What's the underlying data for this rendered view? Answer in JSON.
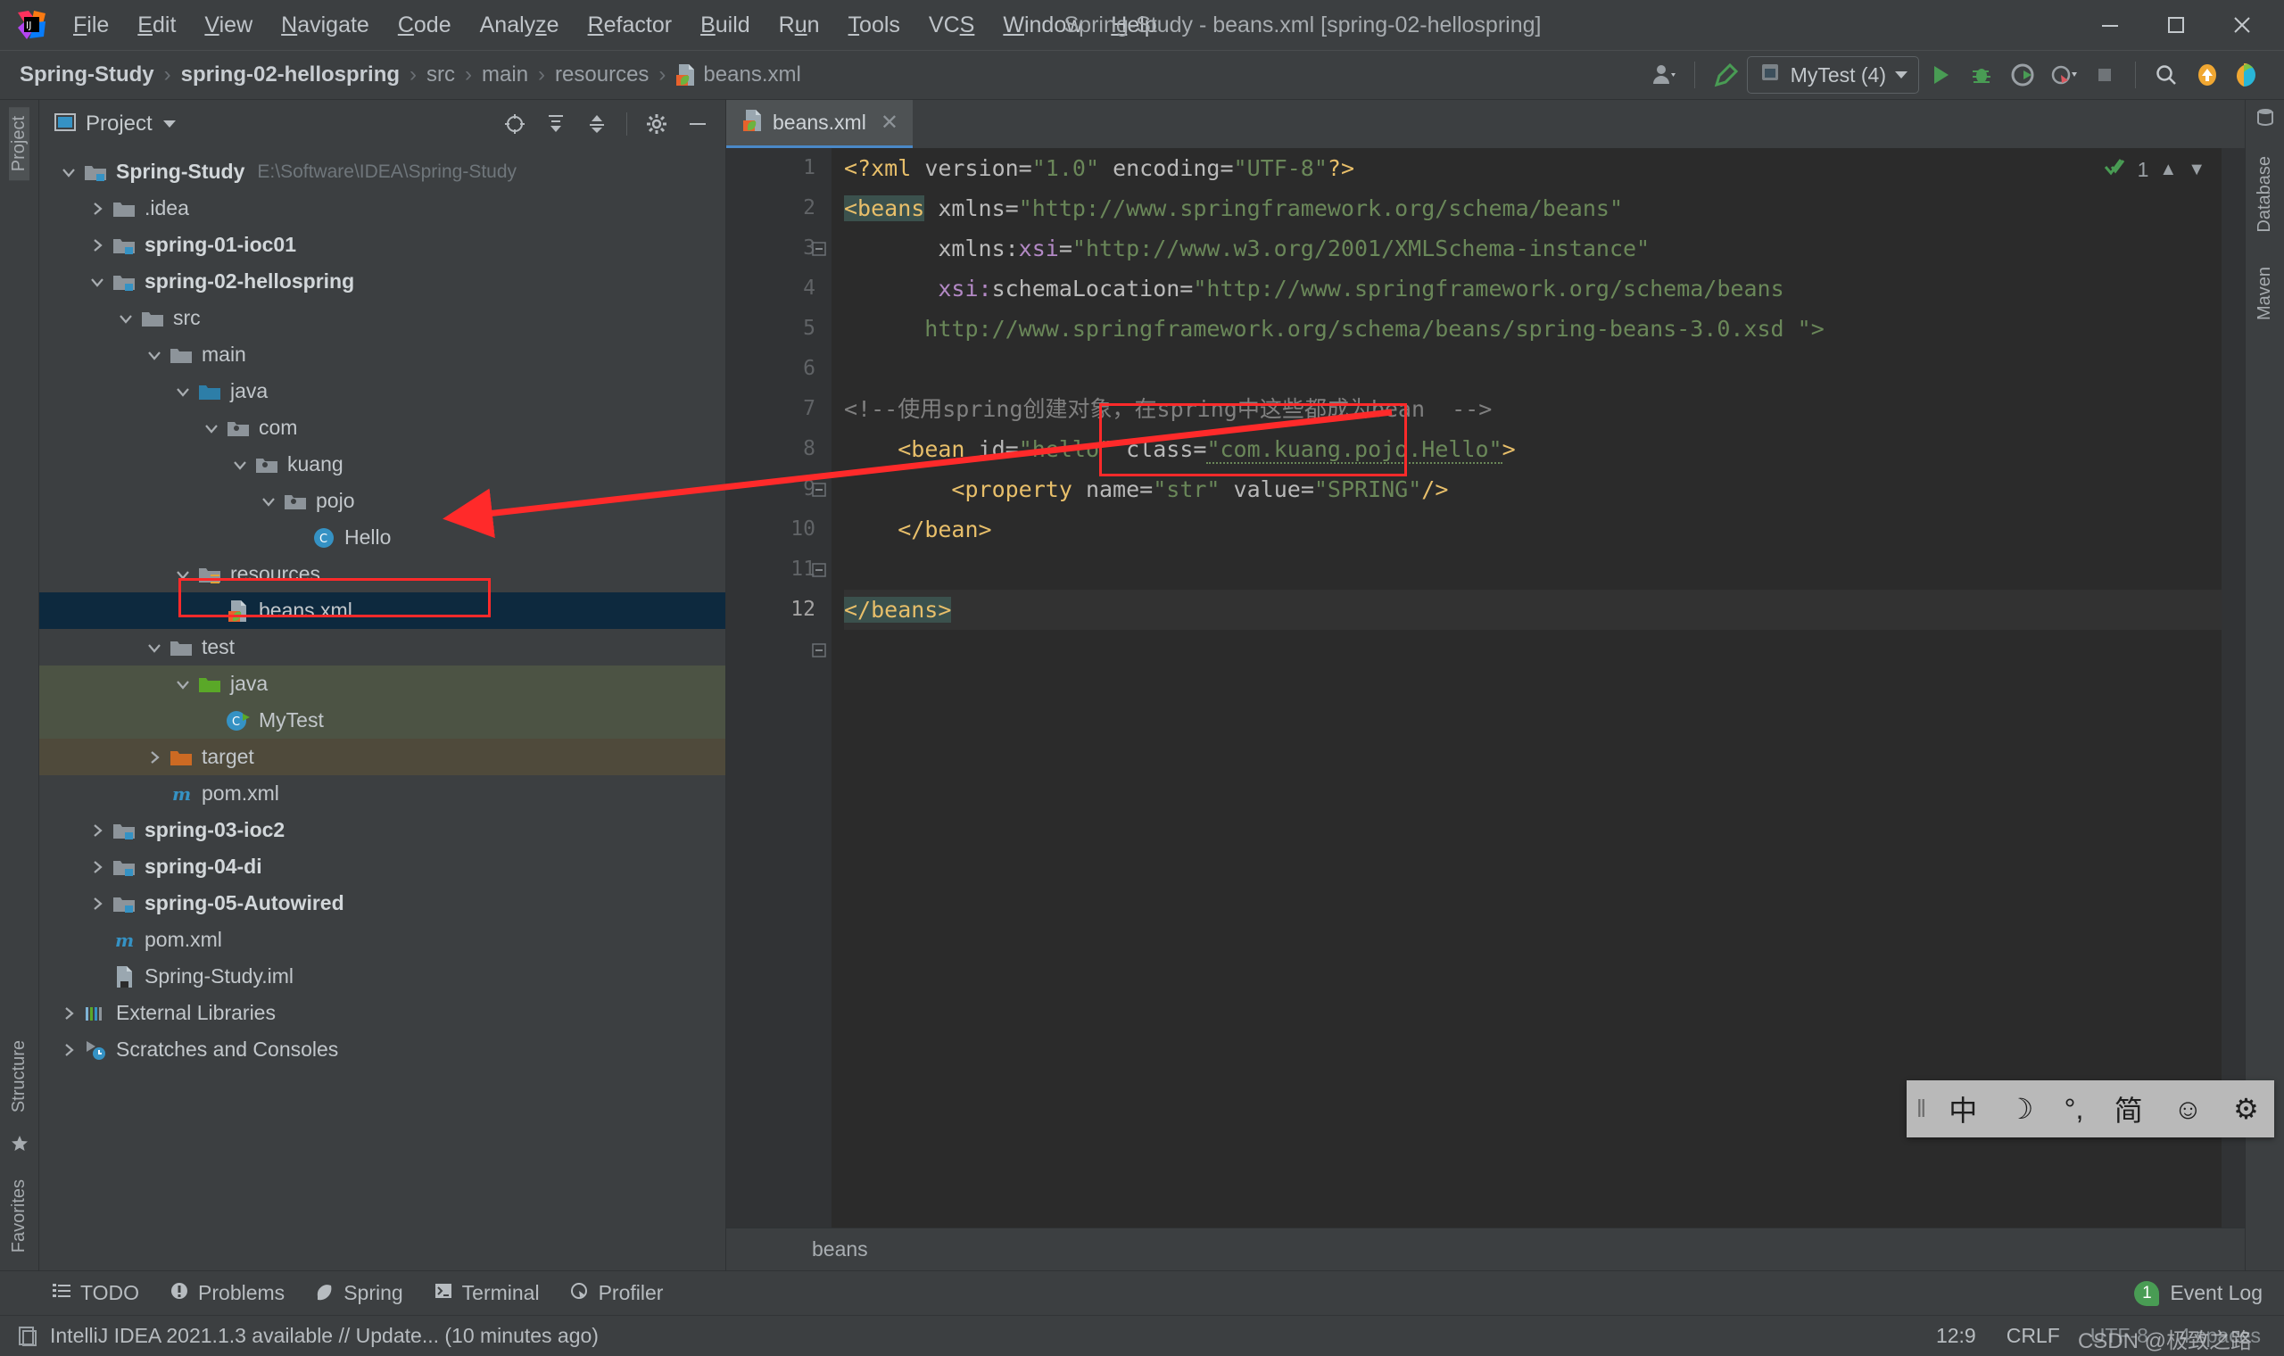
{
  "window": {
    "title": "Spring-Study - beans.xml [spring-02-hellospring]",
    "minimize": "minimize-icon",
    "maximize": "maximize-icon",
    "close": "close-icon"
  },
  "menubar": {
    "items": [
      {
        "label": "File",
        "mnemonic": "F"
      },
      {
        "label": "Edit",
        "mnemonic": "E"
      },
      {
        "label": "View",
        "mnemonic": "V"
      },
      {
        "label": "Navigate",
        "mnemonic": "N"
      },
      {
        "label": "Code",
        "mnemonic": "C"
      },
      {
        "label": "Analyze",
        "mnemonic": "z"
      },
      {
        "label": "Refactor",
        "mnemonic": "R"
      },
      {
        "label": "Build",
        "mnemonic": "B"
      },
      {
        "label": "Run",
        "mnemonic": "u"
      },
      {
        "label": "Tools",
        "mnemonic": "T"
      },
      {
        "label": "VCS",
        "mnemonic": "S"
      },
      {
        "label": "Window",
        "mnemonic": "W"
      },
      {
        "label": "Help",
        "mnemonic": "H"
      }
    ]
  },
  "breadcrumb": {
    "separator": "›",
    "items": [
      {
        "label": "Spring-Study",
        "bold": true
      },
      {
        "label": "spring-02-hellospring",
        "bold": true
      },
      {
        "label": "src",
        "bold": false
      },
      {
        "label": "main",
        "bold": false
      },
      {
        "label": "resources",
        "bold": false
      },
      {
        "label": "beans.xml",
        "bold": false,
        "icon": "spring-xml-file-icon"
      }
    ]
  },
  "toolbar": {
    "user_icon": "user-account-icon",
    "build_icon": "build-hammer-icon",
    "run_config": "MyTest (4)",
    "run_config_icon": "run-configuration-icon",
    "run_icon": "run-play-icon",
    "debug_icon": "debug-bug-icon",
    "run_coverage_icon": "run-with-coverage-icon",
    "profiler_icon": "profiler-icon",
    "stop_icon": "stop-icon",
    "search_icon": "search-everywhere-icon",
    "update_icon": "update-project-icon",
    "ide_icon": "ide-logo-icon"
  },
  "project_panel": {
    "title": "Project",
    "title_caret": "chevron-down-icon",
    "actions": [
      {
        "name": "select-opened-file-icon"
      },
      {
        "name": "expand-all-icon"
      },
      {
        "name": "collapse-all-icon"
      },
      {
        "name": "gear-icon"
      },
      {
        "name": "hide-icon"
      }
    ],
    "tree": [
      {
        "label": "Spring-Study",
        "path": "E:\\Software\\IDEA\\Spring-Study",
        "depth": 0,
        "twisty": "down",
        "icon": "module-folder-icon",
        "bold": true
      },
      {
        "label": ".idea",
        "depth": 1,
        "twisty": "right",
        "icon": "folder-icon",
        "bold": false
      },
      {
        "label": "spring-01-ioc01",
        "depth": 1,
        "twisty": "right",
        "icon": "module-folder-icon",
        "bold": true
      },
      {
        "label": "spring-02-hellospring",
        "depth": 1,
        "twisty": "down",
        "icon": "module-folder-icon",
        "bold": true
      },
      {
        "label": "src",
        "depth": 2,
        "twisty": "down",
        "icon": "folder-icon",
        "bold": false
      },
      {
        "label": "main",
        "depth": 3,
        "twisty": "down",
        "icon": "folder-icon",
        "bold": false
      },
      {
        "label": "java",
        "depth": 4,
        "twisty": "down",
        "icon": "source-root-folder-icon",
        "bold": false
      },
      {
        "label": "com",
        "depth": 5,
        "twisty": "down",
        "icon": "package-icon",
        "bold": false
      },
      {
        "label": "kuang",
        "depth": 6,
        "twisty": "down",
        "icon": "package-icon",
        "bold": false
      },
      {
        "label": "pojo",
        "depth": 7,
        "twisty": "down",
        "icon": "package-icon",
        "bold": false
      },
      {
        "label": "Hello",
        "depth": 8,
        "twisty": "none",
        "icon": "java-class-icon",
        "bold": false
      },
      {
        "label": "resources",
        "depth": 4,
        "twisty": "down",
        "icon": "resources-root-folder-icon",
        "bold": false
      },
      {
        "label": "beans.xml",
        "depth": 5,
        "twisty": "none",
        "icon": "spring-xml-file-icon",
        "bold": false,
        "state": "selected"
      },
      {
        "label": "test",
        "depth": 3,
        "twisty": "down",
        "icon": "folder-icon",
        "bold": false
      },
      {
        "label": "java",
        "depth": 4,
        "twisty": "down",
        "icon": "test-source-root-folder-icon",
        "bold": false,
        "state": "green"
      },
      {
        "label": "MyTest",
        "depth": 5,
        "twisty": "none",
        "icon": "java-test-class-icon",
        "bold": false,
        "state": "green"
      },
      {
        "label": "target",
        "depth": 3,
        "twisty": "right",
        "icon": "excluded-folder-icon",
        "bold": false,
        "state": "olive"
      },
      {
        "label": "pom.xml",
        "depth": 3,
        "twisty": "none",
        "icon": "maven-file-icon",
        "bold": false
      },
      {
        "label": "spring-03-ioc2",
        "depth": 1,
        "twisty": "right",
        "icon": "module-folder-icon",
        "bold": true
      },
      {
        "label": "spring-04-di",
        "depth": 1,
        "twisty": "right",
        "icon": "module-folder-icon",
        "bold": true
      },
      {
        "label": "spring-05-Autowired",
        "depth": 1,
        "twisty": "right",
        "icon": "module-folder-icon",
        "bold": true
      },
      {
        "label": "pom.xml",
        "depth": 1,
        "twisty": "none",
        "icon": "maven-file-icon",
        "bold": false
      },
      {
        "label": "Spring-Study.iml",
        "depth": 1,
        "twisty": "none",
        "icon": "iml-file-icon",
        "bold": false
      },
      {
        "label": "External Libraries",
        "depth": 0,
        "twisty": "right",
        "icon": "external-libraries-icon",
        "bold": false
      },
      {
        "label": "Scratches and Consoles",
        "depth": 0,
        "twisty": "right",
        "icon": "scratches-icon",
        "bold": false
      }
    ]
  },
  "left_stripe": {
    "top_tab": "Project",
    "bottom_tabs": [
      "Structure",
      "Favorites"
    ]
  },
  "right_stripe": {
    "tabs": [
      "Database",
      "Maven"
    ]
  },
  "editor": {
    "tab": {
      "label": "beans.xml",
      "icon": "spring-xml-file-icon",
      "close": "close-icon"
    },
    "inspection_count": "1",
    "inspection_icon": "inspection-ok-icon",
    "prev_icon": "chevron-up-icon",
    "next_icon": "chevron-down-icon",
    "breadcrumb_bottom": "beans",
    "lines": [
      {
        "n": 1,
        "segments": [
          {
            "t": "<?xml ",
            "c": "tag"
          },
          {
            "t": "version",
            "c": "attr"
          },
          {
            "t": "=",
            "c": "attr"
          },
          {
            "t": "\"1.0\"",
            "c": "val"
          },
          {
            "t": " ",
            "c": "attr"
          },
          {
            "t": "encoding",
            "c": "attr"
          },
          {
            "t": "=",
            "c": "attr"
          },
          {
            "t": "\"UTF-8\"",
            "c": "val"
          },
          {
            "t": "?>",
            "c": "tag"
          }
        ]
      },
      {
        "n": 2,
        "segments": [
          {
            "t": "<beans",
            "c": "tag hl"
          },
          {
            "t": " ",
            "c": "attr"
          },
          {
            "t": "xmlns",
            "c": "attr"
          },
          {
            "t": "=",
            "c": "attr"
          },
          {
            "t": "\"http://www.springframework.org/schema/beans\"",
            "c": "val"
          }
        ]
      },
      {
        "n": 3,
        "segments": [
          {
            "t": "       ",
            "c": "attr"
          },
          {
            "t": "xmlns:",
            "c": "attr"
          },
          {
            "t": "xsi",
            "c": "ns"
          },
          {
            "t": "=",
            "c": "attr"
          },
          {
            "t": "\"http://www.w3.org/2001/XMLSchema-instance\"",
            "c": "val"
          }
        ]
      },
      {
        "n": 4,
        "segments": [
          {
            "t": "       ",
            "c": "attr"
          },
          {
            "t": "xsi:",
            "c": "ns"
          },
          {
            "t": "schemaLocation",
            "c": "attr"
          },
          {
            "t": "=",
            "c": "attr"
          },
          {
            "t": "\"http://www.springframework.org/schema/beans",
            "c": "val"
          }
        ]
      },
      {
        "n": 5,
        "segments": [
          {
            "t": "      http://www.springframework.org/schema/beans/spring-beans-3.0.xsd \">",
            "c": "val"
          }
        ]
      },
      {
        "n": 6,
        "segments": []
      },
      {
        "n": 7,
        "segments": [
          {
            "t": "<!--使用spring创建对象，在spring中这些都成为bean  -->",
            "c": "cmt"
          }
        ]
      },
      {
        "n": 8,
        "segments": [
          {
            "t": "    ",
            "c": "attr"
          },
          {
            "t": "<bean ",
            "c": "tag"
          },
          {
            "t": "id",
            "c": "attr"
          },
          {
            "t": "=",
            "c": "attr"
          },
          {
            "t": "\"hello\"",
            "c": "val"
          },
          {
            "t": " ",
            "c": "attr"
          },
          {
            "t": "class",
            "c": "attr"
          },
          {
            "t": "=",
            "c": "attr"
          },
          {
            "t": "\"com.kuang.pojo.Hello\"",
            "c": "val wavy"
          },
          {
            "t": ">",
            "c": "tag"
          }
        ]
      },
      {
        "n": 9,
        "segments": [
          {
            "t": "        ",
            "c": "attr"
          },
          {
            "t": "<property ",
            "c": "tag"
          },
          {
            "t": "name",
            "c": "attr"
          },
          {
            "t": "=",
            "c": "attr"
          },
          {
            "t": "\"str\"",
            "c": "val"
          },
          {
            "t": " ",
            "c": "attr"
          },
          {
            "t": "value",
            "c": "attr"
          },
          {
            "t": "=",
            "c": "attr"
          },
          {
            "t": "\"SPRING\"",
            "c": "val"
          },
          {
            "t": "/>",
            "c": "tag"
          }
        ]
      },
      {
        "n": 10,
        "segments": [
          {
            "t": "    ",
            "c": "attr"
          },
          {
            "t": "</bean>",
            "c": "tag"
          }
        ]
      },
      {
        "n": 11,
        "segments": []
      },
      {
        "n": 12,
        "segments": [
          {
            "t": "</beans>",
            "c": "tag hl"
          }
        ],
        "current": true
      }
    ]
  },
  "bottom_tools": {
    "items": [
      {
        "label": "TODO",
        "icon": "todo-icon"
      },
      {
        "label": "Problems",
        "icon": "problems-icon"
      },
      {
        "label": "Spring",
        "icon": "spring-leaf-icon"
      },
      {
        "label": "Terminal",
        "icon": "terminal-icon"
      },
      {
        "label": "Profiler",
        "icon": "profiler-icon"
      }
    ],
    "event_log": {
      "label": "Event Log",
      "count": "1"
    }
  },
  "statusbar": {
    "message_icon": "notification-icon",
    "message": "IntelliJ IDEA 2021.1.3 available // Update... (10 minutes ago)",
    "caret": "12:9",
    "line_separator": "CRLF",
    "encoding": "UTF-8",
    "indent": "4 spaces",
    "watermark": "CSDN @极致之路"
  },
  "ime_toolbar": {
    "handle": "drag-handle-icon",
    "buttons": [
      {
        "label": "中",
        "name": "language-mode-chinese"
      },
      {
        "label": "☽",
        "name": "moon-icon"
      },
      {
        "label": "°,",
        "name": "punctuation-mode-icon"
      },
      {
        "label": "简",
        "name": "simplified-chinese-icon"
      },
      {
        "label": "☺",
        "name": "emoji-icon"
      },
      {
        "label": "⚙",
        "name": "ime-settings-gear-icon"
      }
    ]
  },
  "colors": {
    "accent_blue": "#4a88c7",
    "selection_blue": "#0d293e",
    "annotation_red": "#ff2a2a",
    "tag_yellow": "#e8bf6a",
    "string_green": "#6a8759",
    "comment_gray": "#808080",
    "ns_violet": "#b389c5"
  }
}
